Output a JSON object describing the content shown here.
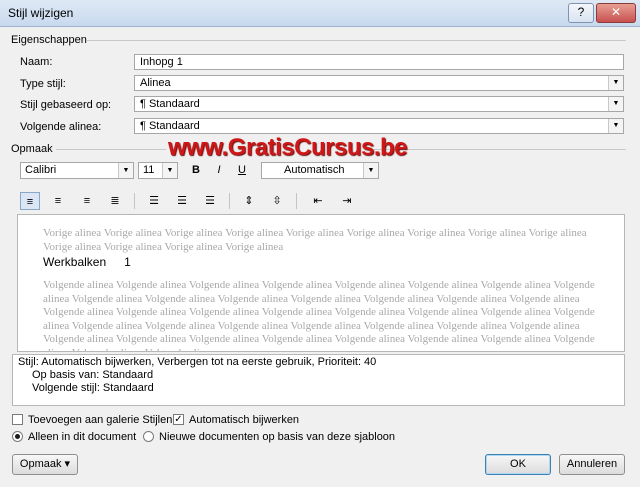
{
  "window": {
    "title": "Stijl wijzigen",
    "help_label": "?",
    "close_label": "✕"
  },
  "properties": {
    "section_label": "Eigenschappen",
    "name_label": "Naam:",
    "name_value": "Inhopg 1",
    "type_label": "Type stijl:",
    "type_value": "Alinea",
    "based_label": "Stijl gebaseerd op:",
    "based_value": "¶  Standaard",
    "next_label": "Volgende alinea:",
    "next_value": "¶  Standaard"
  },
  "format": {
    "section_label": "Opmaak",
    "font": "Calibri",
    "size": "11",
    "bold": "B",
    "italic": "I",
    "underline": "U",
    "color": "Automatisch"
  },
  "watermark": "www.GratisCursus.be",
  "preview": {
    "previous_text": "Vorige alinea Vorige alinea Vorige alinea Vorige alinea Vorige alinea Vorige alinea Vorige alinea Vorige alinea Vorige alinea Vorige alinea Vorige alinea Vorige alinea Vorige alinea",
    "sample_word": "Werkbalken",
    "sample_num": "1",
    "next_text": "Volgende alinea Volgende alinea Volgende alinea Volgende alinea Volgende alinea Volgende alinea Volgende alinea Volgende alinea Volgende alinea Volgende alinea Volgende alinea Volgende alinea Volgende alinea Volgende alinea Volgende alinea Volgende alinea Volgende alinea Volgende alinea Volgende alinea Volgende alinea Volgende alinea Volgende alinea Volgende alinea Volgende alinea Volgende alinea Volgende alinea Volgende alinea Volgende alinea Volgende alinea Volgende alinea Volgende alinea Volgende alinea Volgende alinea Volgende alinea Volgende alinea Volgende alinea Volgende alinea Volgende alinea Volgende alinea Volgende alinea"
  },
  "description": {
    "line1": "Stijl: Automatisch bijwerken, Verbergen tot na eerste gebruik, Prioriteit: 40",
    "line2": "Op basis van: Standaard",
    "line3": "Volgende stijl: Standaard"
  },
  "options": {
    "add_gallery": "Toevoegen aan galerie Stijlen",
    "auto_update": "Automatisch bijwerken",
    "only_doc": "Alleen in dit document",
    "new_docs": "Nieuwe documenten op basis van deze sjabloon"
  },
  "buttons": {
    "format": "Opmaak ▾",
    "ok": "OK",
    "cancel": "Annuleren"
  }
}
